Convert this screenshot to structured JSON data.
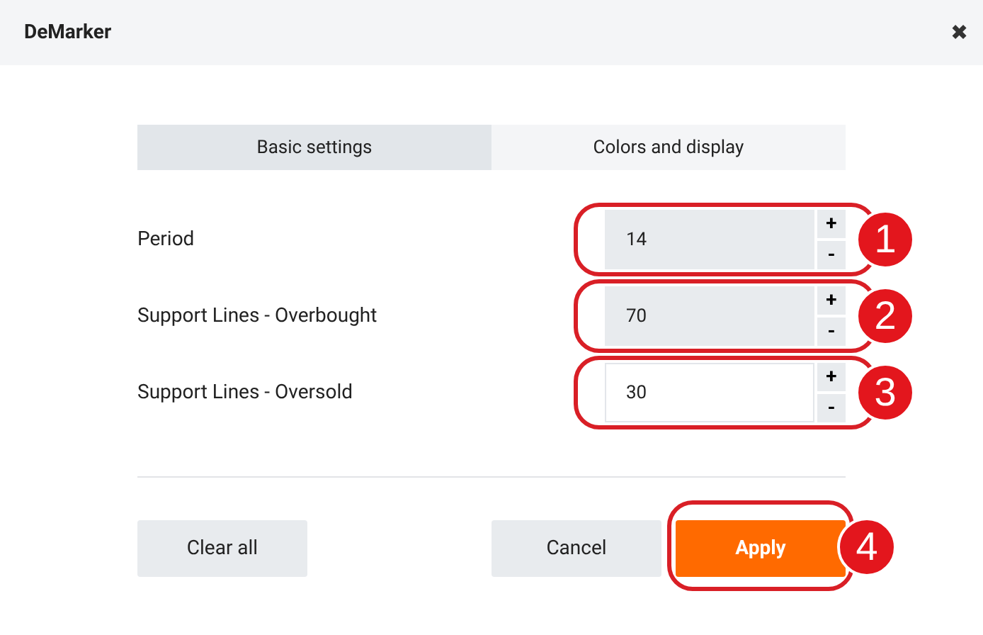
{
  "window": {
    "title": "DeMarker",
    "close": "✖"
  },
  "tabs": [
    {
      "label": "Basic settings",
      "selected": true
    },
    {
      "label": "Colors and display",
      "selected": false
    }
  ],
  "fields": [
    {
      "label": "Period",
      "value": "14",
      "focused": false,
      "plus": "+",
      "minus": "-",
      "callout": "1"
    },
    {
      "label": "Support Lines - Overbought",
      "value": "70",
      "focused": false,
      "plus": "+",
      "minus": "-",
      "callout": "2"
    },
    {
      "label": "Support Lines - Oversold",
      "value": "30",
      "focused": true,
      "plus": "+",
      "minus": "-",
      "callout": "3"
    }
  ],
  "buttons": [
    {
      "label": "Clear all",
      "kind": "secondary"
    },
    {
      "label": "Cancel",
      "kind": "secondary"
    },
    {
      "label": "Apply",
      "kind": "primary",
      "callout": "4"
    }
  ]
}
